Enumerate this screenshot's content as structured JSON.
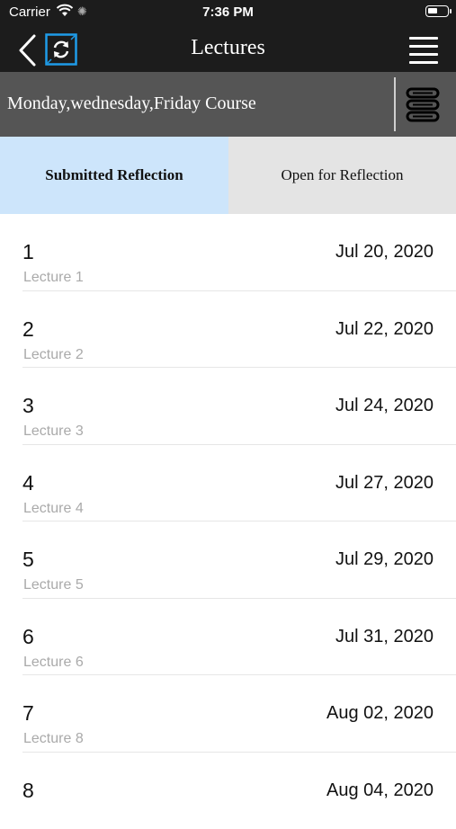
{
  "status_bar": {
    "carrier": "Carrier",
    "time": "7:36 PM"
  },
  "nav": {
    "title": "Lectures",
    "back_icon": "chevron-left-icon",
    "sync_icon": "sync-icon",
    "menu_icon": "hamburger-menu-icon"
  },
  "course": {
    "name": "Monday,wednesday,Friday Course",
    "switch_icon": "course-list-icon"
  },
  "tabs": [
    {
      "label": "Submitted Reflection",
      "active": true
    },
    {
      "label": "Open for Reflection",
      "active": false
    }
  ],
  "lectures": [
    {
      "number": "1",
      "name": "Lecture 1",
      "date": "Jul 20, 2020"
    },
    {
      "number": "2",
      "name": "Lecture 2",
      "date": "Jul 22, 2020"
    },
    {
      "number": "3",
      "name": "Lecture 3",
      "date": "Jul 24, 2020"
    },
    {
      "number": "4",
      "name": "Lecture 4",
      "date": "Jul 27, 2020"
    },
    {
      "number": "5",
      "name": "Lecture 5",
      "date": "Jul 29, 2020"
    },
    {
      "number": "6",
      "name": "Lecture 6",
      "date": "Jul 31, 2020"
    },
    {
      "number": "7",
      "name": "Lecture 8",
      "date": "Aug 02, 2020"
    },
    {
      "number": "8",
      "name": "",
      "date": "Aug 04, 2020"
    }
  ],
  "colors": {
    "nav_background": "#1c1c1c",
    "course_bar_background": "#555555",
    "active_tab": "#cde5fb",
    "inactive_tab": "#e4e4e4",
    "accent": "#1e9be8"
  }
}
